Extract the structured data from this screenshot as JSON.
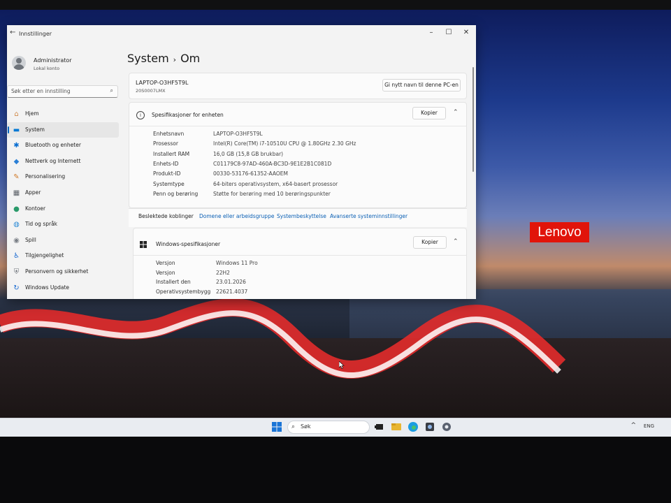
{
  "window": {
    "app_title": "Innstillinger",
    "back_label": "←",
    "minimize": "–",
    "maximize": "☐",
    "close": "✕"
  },
  "user": {
    "name": "Administrator",
    "account": "Lokal konto"
  },
  "search": {
    "placeholder": "Søk etter en innstilling",
    "icon": "⌕"
  },
  "sidebar": {
    "items": [
      {
        "label": "Hjem",
        "icon": "home-icon",
        "glyph": "⌂",
        "color": "#d08a4a"
      },
      {
        "label": "System",
        "icon": "monitor-icon",
        "glyph": "▬",
        "color": "#0078d4",
        "active": true
      },
      {
        "label": "Bluetooth og enheter",
        "icon": "bluetooth-icon",
        "glyph": "✱",
        "color": "#0a6ed1"
      },
      {
        "label": "Nettverk og Internett",
        "icon": "wifi-icon",
        "glyph": "◆",
        "color": "#2a7fd6"
      },
      {
        "label": "Personalisering",
        "icon": "brush-icon",
        "glyph": "✎",
        "color": "#d07a2a"
      },
      {
        "label": "Apper",
        "icon": "apps-icon",
        "glyph": "▦",
        "color": "#5a5f66"
      },
      {
        "label": "Kontoer",
        "icon": "person-icon",
        "glyph": "●",
        "color": "#2a9a6a"
      },
      {
        "label": "Tid og språk",
        "icon": "globe-icon",
        "glyph": "◍",
        "color": "#2a8ad6"
      },
      {
        "label": "Spill",
        "icon": "gamepad-icon",
        "glyph": "◉",
        "color": "#7a7f86"
      },
      {
        "label": "Tilgjengelighet",
        "icon": "accessibility-icon",
        "glyph": "♿",
        "color": "#1a6ad0"
      },
      {
        "label": "Personvern og sikkerhet",
        "icon": "shield-icon",
        "glyph": "⛨",
        "color": "#6a6f76"
      },
      {
        "label": "Windows Update",
        "icon": "update-icon",
        "glyph": "↻",
        "color": "#1a6ad0"
      }
    ]
  },
  "breadcrumb": {
    "parent": "System",
    "separator": "›",
    "current": "Om"
  },
  "device_card": {
    "pc_name": "LAPTOP-O3HF5T9L",
    "model": "20S0007LMX",
    "rename_button": "Gi nytt navn til denne PC-en"
  },
  "device_specs": {
    "title": "Spesifikasjoner for enheten",
    "copy_button": "Kopier",
    "rows": [
      {
        "key": "Enhetsnavn",
        "value": "LAPTOP-O3HF5T9L"
      },
      {
        "key": "Prosessor",
        "value": "Intel(R) Core(TM) i7-10510U CPU @ 1.80GHz   2.30 GHz"
      },
      {
        "key": "Installert RAM",
        "value": "16,0 GB (15,8 GB brukbar)"
      },
      {
        "key": "Enhets-ID",
        "value": "C01179C8-97AD-460A-BC3D-9E1E2B1C081D"
      },
      {
        "key": "Produkt-ID",
        "value": "00330-53176-61352-AAOEM"
      },
      {
        "key": "Systemtype",
        "value": "64-biters operativsystem, x64-basert prosessor"
      },
      {
        "key": "Penn og berøring",
        "value": "Støtte for berøring med 10 berøringspunkter"
      }
    ]
  },
  "related_links": {
    "label": "Beslektede koblinger",
    "links": [
      "Domene eller arbeidsgruppe",
      "Systembeskyttelse",
      "Avanserte systeminnstillinger"
    ]
  },
  "windows_specs": {
    "title": "Windows-spesifikasjoner",
    "copy_button": "Kopier",
    "rows": [
      {
        "key": "Versjon",
        "value": "Windows 11 Pro"
      },
      {
        "key": "Versjon",
        "value": "22H2"
      },
      {
        "key": "Installert den",
        "value": "23.01.2026"
      },
      {
        "key": "Operativsystembygg",
        "value": "22621.4037"
      }
    ]
  },
  "desktop": {
    "brand": "Lenovo"
  },
  "taskbar": {
    "search_label": "Søk",
    "tray_lang": "ENG",
    "tray_caret": "^"
  },
  "colors": {
    "accent": "#0067c0",
    "link": "#0a5fb4",
    "lenovo_red": "#e1140a"
  }
}
